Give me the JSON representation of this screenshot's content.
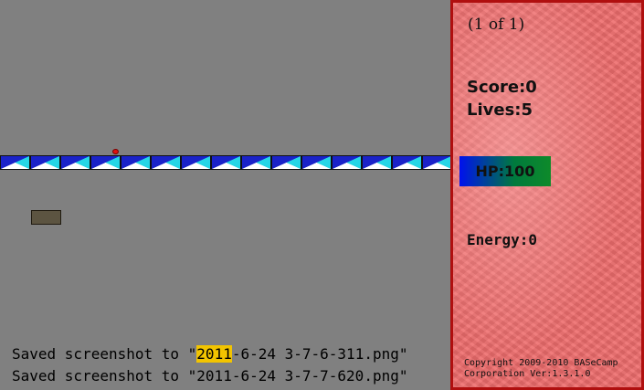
{
  "hud": {
    "level": "(1 of 1)",
    "score": "Score:0",
    "lives": "Lives:5",
    "hp": "HP:100",
    "hp_fraction": 1.0,
    "energy": "Energy:0",
    "copyright_line1": "Copyright 2009-2010 BASeCamp",
    "copyright_line2": "Corporation Ver:1.3.1.0"
  },
  "console": {
    "line1_prefix": "Saved screenshot to \"",
    "line1_highlight": "2011",
    "line1_suffix": "-6-24 3-7-6-311.png\"",
    "line2": "Saved screenshot to \"2011-6-24 3-7-7-620.png\""
  },
  "colors": {
    "background": "#808080",
    "hud_panel": "#ee6d6d",
    "hud_border": "#b00f0f",
    "brick_dark": "#1a22c8",
    "brick_light": "#26d6e6",
    "ball": "#e01010",
    "paddle": "#5c5441"
  },
  "bricks": {
    "count": 15
  }
}
